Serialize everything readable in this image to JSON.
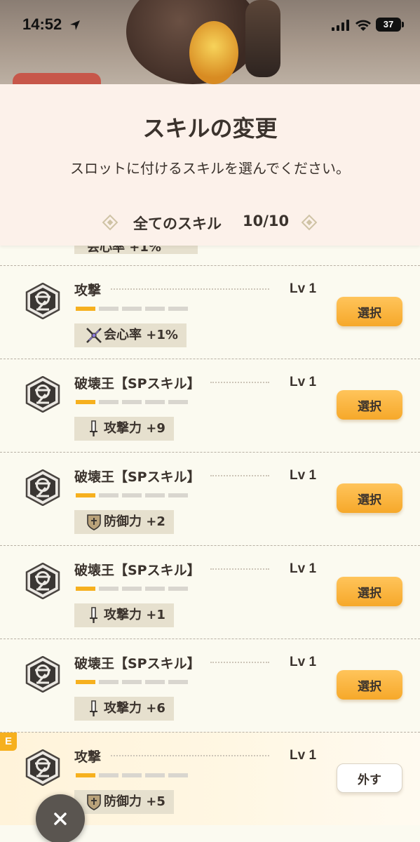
{
  "status_bar": {
    "time": "14:52",
    "battery": "37"
  },
  "header": {
    "title": "スキルの変更",
    "subtitle": "スロットに付けるスキルを選んでください。",
    "filter_label": "全てのスキル",
    "filter_count": "10/10"
  },
  "partial_item": {
    "stat": "会心率 +1%"
  },
  "skills": [
    {
      "name": "攻撃",
      "level": "Lv 1",
      "level_value": 1,
      "level_max": 5,
      "stat": "会心率 +1%",
      "stat_icon": "crit-icon",
      "action": "選択"
    },
    {
      "name": "破壊王【SPスキル】",
      "level": "Lv 1",
      "level_value": 1,
      "level_max": 5,
      "stat": "攻撃力 +9",
      "stat_icon": "sword-icon",
      "action": "選択"
    },
    {
      "name": "破壊王【SPスキル】",
      "level": "Lv 1",
      "level_value": 1,
      "level_max": 5,
      "stat": "防御力 +2",
      "stat_icon": "shield-icon",
      "action": "選択"
    },
    {
      "name": "破壊王【SPスキル】",
      "level": "Lv 1",
      "level_value": 1,
      "level_max": 5,
      "stat": "攻撃力 +1",
      "stat_icon": "sword-icon",
      "action": "選択"
    },
    {
      "name": "破壊王【SPスキル】",
      "level": "Lv 1",
      "level_value": 1,
      "level_max": 5,
      "stat": "攻撃力 +6",
      "stat_icon": "sword-icon",
      "action": "選択"
    },
    {
      "name": "攻撃",
      "level": "Lv 1",
      "level_value": 1,
      "level_max": 5,
      "stat": "防御力 +5",
      "stat_icon": "shield-icon",
      "action": "外す",
      "equipped": true,
      "equipped_badge": "E"
    }
  ],
  "colors": {
    "accent": "#f6b01e",
    "background": "#fbfaf0",
    "header": "#fcf1ea",
    "tag": "#e6e0ce",
    "text": "#3b332d"
  },
  "icons": {
    "close": "close-icon",
    "skill": "skill-emblem-icon"
  }
}
